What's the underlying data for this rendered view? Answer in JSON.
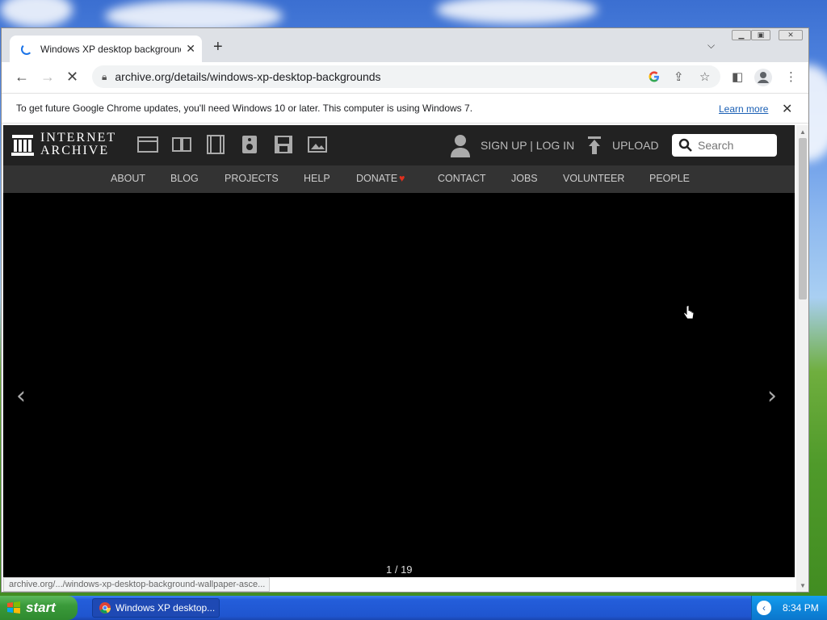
{
  "browser": {
    "tab_title": "Windows XP desktop backgrounds :",
    "new_tab": "+",
    "url": "archive.org/details/windows-xp-desktop-backgrounds",
    "infobar_text": "To get future Google Chrome updates, you'll need Windows 10 or later. This computer is using Windows 7.",
    "infobar_link": "Learn more",
    "status_url": "archive.org/.../windows-xp-desktop-background-wallpaper-asce..."
  },
  "ia": {
    "logo_line1": "INTERNET",
    "logo_line2": "ARCHIVE",
    "signup": "SIGN UP | LOG IN",
    "upload": "UPLOAD",
    "search_placeholder": "Search",
    "nav": [
      "ABOUT",
      "BLOG",
      "PROJECTS",
      "HELP",
      "DONATE",
      "CONTACT",
      "JOBS",
      "VOLUNTEER",
      "PEOPLE"
    ],
    "counter": "1 / 19"
  },
  "taskbar": {
    "start": "start",
    "task_label": "Windows XP desktop...",
    "clock": "8:34 PM"
  },
  "icons": {
    "media": [
      "web-icon",
      "texts-icon",
      "video-icon",
      "audio-icon",
      "software-icon",
      "images-icon"
    ]
  },
  "colors": {
    "ia_header": "#222222",
    "ia_nav": "#333333",
    "donate_heart": "#e0301e",
    "link": "#1a5fb4"
  }
}
